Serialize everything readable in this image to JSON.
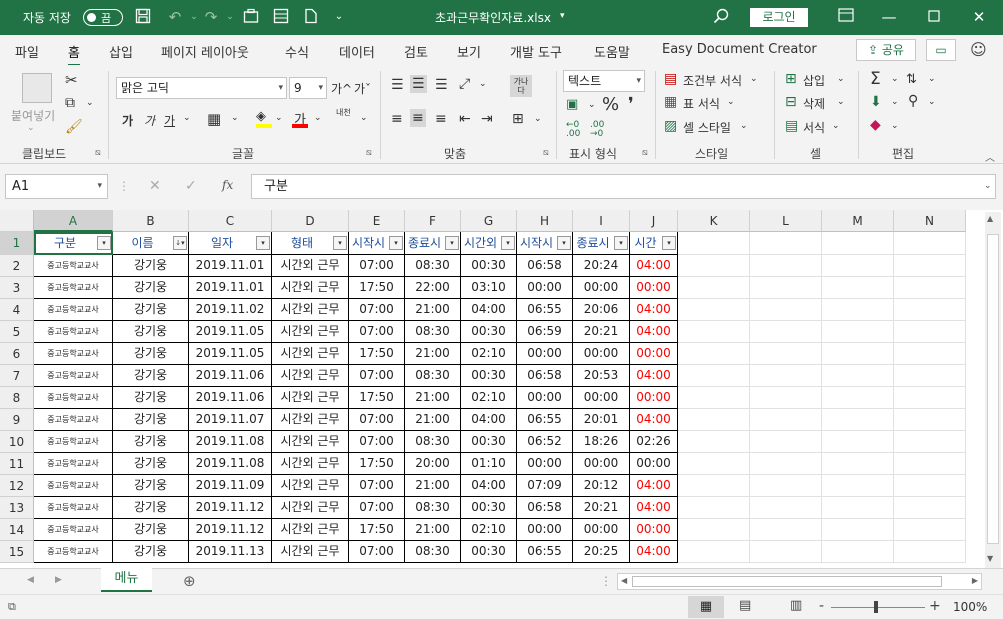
{
  "titlebar": {
    "autosave_label": "자동 저장",
    "toggle_state": "끔",
    "filename": "초과근무확인자료.xlsx",
    "login": "로그인"
  },
  "tabs": [
    "파일",
    "홈",
    "삽입",
    "페이지 레이아웃",
    "수식",
    "데이터",
    "검토",
    "보기",
    "개발 도구",
    "도움말",
    "Easy Document Creator"
  ],
  "active_tab": "홈",
  "share_label": "공유",
  "ribbon": {
    "clipboard": {
      "label": "클립보드",
      "paste": "붙여넣기"
    },
    "font": {
      "label": "글꼴",
      "name": "맑은 고딕",
      "size": "9",
      "bold": "가",
      "italic": "가",
      "underline": "가",
      "grow": "가^",
      "shrink": "가ˇ",
      "phonetic": "내천"
    },
    "align": {
      "label": "맞춤",
      "wrap": "가나\n다"
    },
    "number": {
      "label": "표시 형식",
      "format": "텍스트"
    },
    "styles": {
      "label": "스타일",
      "cond": "조건부 서식",
      "table": "표 서식",
      "cell": "셀 스타일"
    },
    "cells": {
      "label": "셀",
      "insert": "삽입",
      "delete": "삭제",
      "format": "서식"
    },
    "editing": {
      "label": "편집"
    }
  },
  "formula_bar": {
    "name_box": "A1",
    "fx": "fx",
    "content": "구분"
  },
  "columns": [
    "A",
    "B",
    "C",
    "D",
    "E",
    "F",
    "G",
    "H",
    "I",
    "J",
    "K",
    "L",
    "M",
    "N"
  ],
  "headers": [
    "구분",
    "이름",
    "일자",
    "형태",
    "시작시",
    "종료시",
    "시간외",
    "시작시",
    "종료시",
    "시간"
  ],
  "rows": [
    {
      "n": "2",
      "a": "중고등학교교사",
      "b": "강기웅",
      "c": "2019.11.01",
      "d": "시간외 근무",
      "e": "07:00",
      "f": "08:30",
      "g": "00:30",
      "h": "06:58",
      "i": "20:24",
      "j": "04:00",
      "red": true
    },
    {
      "n": "3",
      "a": "중고등학교교사",
      "b": "강기웅",
      "c": "2019.11.01",
      "d": "시간외 근무",
      "e": "17:50",
      "f": "22:00",
      "g": "03:10",
      "h": "00:00",
      "i": "00:00",
      "j": "00:00",
      "red": true
    },
    {
      "n": "4",
      "a": "중고등학교교사",
      "b": "강기웅",
      "c": "2019.11.02",
      "d": "시간외 근무",
      "e": "07:00",
      "f": "21:00",
      "g": "04:00",
      "h": "06:55",
      "i": "20:06",
      "j": "04:00",
      "red": true
    },
    {
      "n": "5",
      "a": "중고등학교교사",
      "b": "강기웅",
      "c": "2019.11.05",
      "d": "시간외 근무",
      "e": "07:00",
      "f": "08:30",
      "g": "00:30",
      "h": "06:59",
      "i": "20:21",
      "j": "04:00",
      "red": true
    },
    {
      "n": "6",
      "a": "중고등학교교사",
      "b": "강기웅",
      "c": "2019.11.05",
      "d": "시간외 근무",
      "e": "17:50",
      "f": "21:00",
      "g": "02:10",
      "h": "00:00",
      "i": "00:00",
      "j": "00:00",
      "red": true
    },
    {
      "n": "7",
      "a": "중고등학교교사",
      "b": "강기웅",
      "c": "2019.11.06",
      "d": "시간외 근무",
      "e": "07:00",
      "f": "08:30",
      "g": "00:30",
      "h": "06:58",
      "i": "20:53",
      "j": "04:00",
      "red": true
    },
    {
      "n": "8",
      "a": "중고등학교교사",
      "b": "강기웅",
      "c": "2019.11.06",
      "d": "시간외 근무",
      "e": "17:50",
      "f": "21:00",
      "g": "02:10",
      "h": "00:00",
      "i": "00:00",
      "j": "00:00",
      "red": true
    },
    {
      "n": "9",
      "a": "중고등학교교사",
      "b": "강기웅",
      "c": "2019.11.07",
      "d": "시간외 근무",
      "e": "07:00",
      "f": "21:00",
      "g": "04:00",
      "h": "06:55",
      "i": "20:01",
      "j": "04:00",
      "red": true
    },
    {
      "n": "10",
      "a": "중고등학교교사",
      "b": "강기웅",
      "c": "2019.11.08",
      "d": "시간외 근무",
      "e": "07:00",
      "f": "08:30",
      "g": "00:30",
      "h": "06:52",
      "i": "18:26",
      "j": "02:26",
      "red": false
    },
    {
      "n": "11",
      "a": "중고등학교교사",
      "b": "강기웅",
      "c": "2019.11.08",
      "d": "시간외 근무",
      "e": "17:50",
      "f": "20:00",
      "g": "01:10",
      "h": "00:00",
      "i": "00:00",
      "j": "00:00",
      "red": false
    },
    {
      "n": "12",
      "a": "중고등학교교사",
      "b": "강기웅",
      "c": "2019.11.09",
      "d": "시간외 근무",
      "e": "07:00",
      "f": "21:00",
      "g": "04:00",
      "h": "07:09",
      "i": "20:12",
      "j": "04:00",
      "red": true
    },
    {
      "n": "13",
      "a": "중고등학교교사",
      "b": "강기웅",
      "c": "2019.11.12",
      "d": "시간외 근무",
      "e": "07:00",
      "f": "08:30",
      "g": "00:30",
      "h": "06:58",
      "i": "20:21",
      "j": "04:00",
      "red": true
    },
    {
      "n": "14",
      "a": "중고등학교교사",
      "b": "강기웅",
      "c": "2019.11.12",
      "d": "시간외 근무",
      "e": "17:50",
      "f": "21:00",
      "g": "02:10",
      "h": "00:00",
      "i": "00:00",
      "j": "00:00",
      "red": true
    },
    {
      "n": "15",
      "a": "중고등학교교사",
      "b": "강기웅",
      "c": "2019.11.13",
      "d": "시간외 근무",
      "e": "07:00",
      "f": "08:30",
      "g": "00:30",
      "h": "06:55",
      "i": "20:25",
      "j": "04:00",
      "red": true
    }
  ],
  "sheet_tab": "메뉴",
  "status": {
    "zoom": "100%",
    "minus": "-",
    "plus": "+"
  },
  "colors": {
    "excel_green": "#217346",
    "header_blue": "#1f4e9c",
    "red": "#ff0000"
  }
}
